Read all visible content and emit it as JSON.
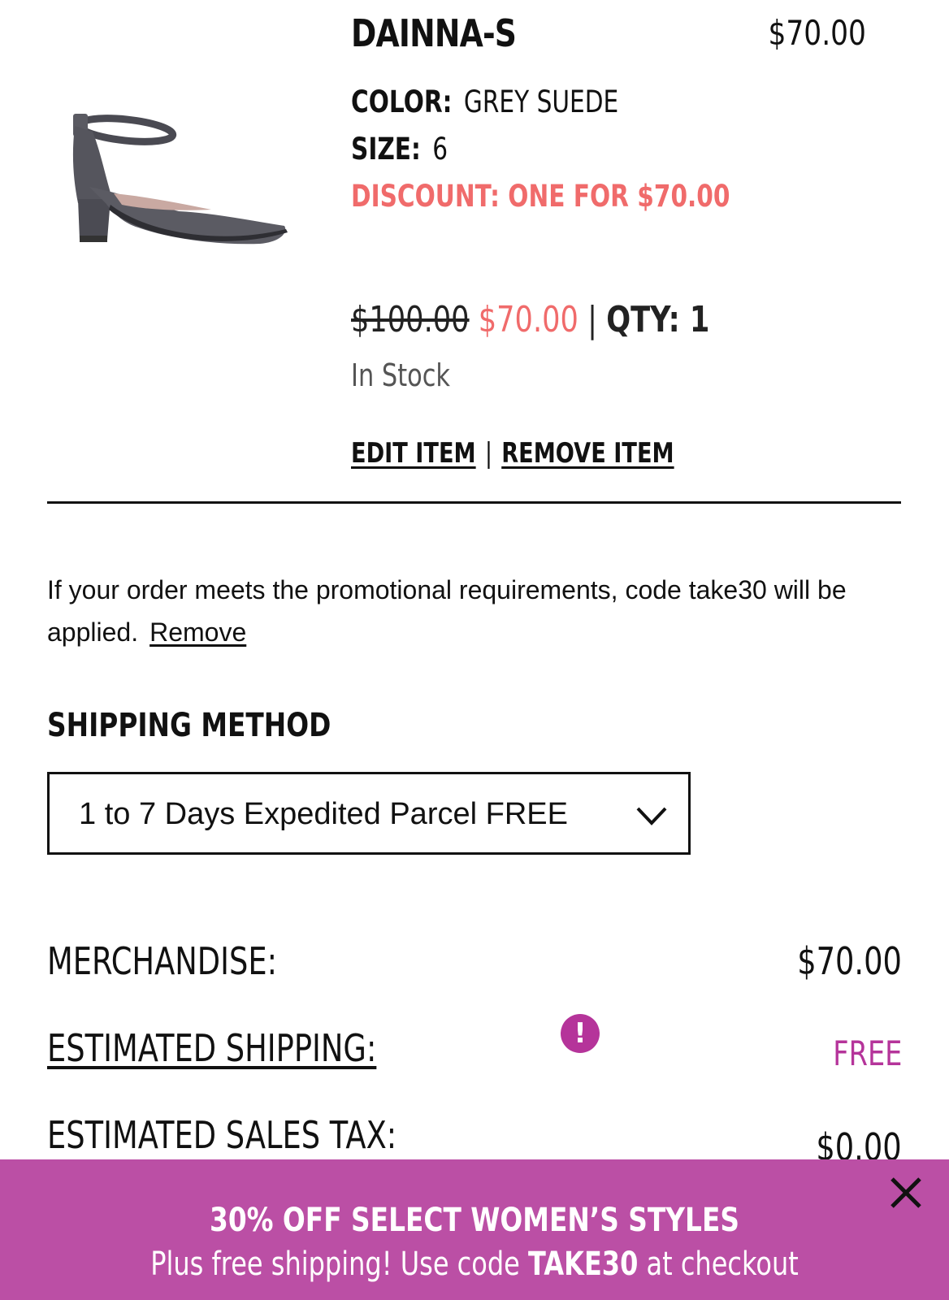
{
  "product": {
    "name": "DAINNA-S",
    "price": "$70.00",
    "color_label": "COLOR:",
    "color_value": "GREY SUEDE",
    "size_label": "SIZE:",
    "size_value": "6",
    "discount": "DISCOUNT: ONE FOR $70.00",
    "original_price": "$100.00",
    "sale_price": "$70.00",
    "separator": "|",
    "qty": "QTY: 1",
    "stock_status": "In Stock",
    "edit_label": "EDIT ITEM",
    "remove_label": "REMOVE ITEM",
    "image_icon": "grey-suede-ankle-strap-heel"
  },
  "promo": {
    "message": "If your order meets the promotional requirements, code take30 will be applied.",
    "remove_label": "Remove"
  },
  "shipping": {
    "heading": "SHIPPING METHOD",
    "selected": "1 to 7 Days Expedited Parcel  FREE"
  },
  "summary": {
    "merchandise_label": "MERCHANDISE:",
    "merchandise_value": "$70.00",
    "shipping_label": "ESTIMATED SHIPPING:",
    "shipping_value": "FREE",
    "tax_label": "ESTIMATED SALES TAX:",
    "tax_value": "$0.00"
  },
  "banner": {
    "headline": "30% OFF SELECT WOMEN’S STYLES",
    "sub_pre": "Plus free shipping! Use code ",
    "sub_code": "TAKE30",
    "sub_post": " at checkout"
  },
  "colors": {
    "accent_pink": "#f06b6b",
    "brand_magenta": "#b5349a",
    "banner_bg": "#bb4fa5"
  }
}
